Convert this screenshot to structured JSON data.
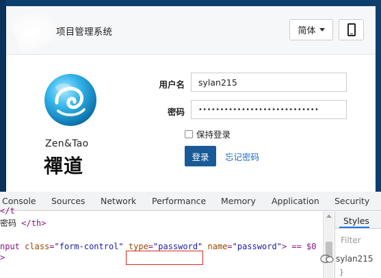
{
  "app": {
    "title": "项目管理系统",
    "lang_label": "简体",
    "mobile_icon": "mobile-phone-icon",
    "logo_text_en": "Zen&Tao",
    "logo_text_cn": "禪道"
  },
  "form": {
    "username_label": "用户名",
    "username_value": "sylan215",
    "password_label": "密码",
    "password_value": "••••••••••••••••••••••••••••",
    "remember_label": "保持登录",
    "login_label": "登录",
    "forgot_label": "忘记密码"
  },
  "devtools": {
    "tabs": [
      "Console",
      "Sources",
      "Network",
      "Performance",
      "Memory",
      "Application",
      "Security"
    ],
    "code": {
      "line1": "</t",
      "line2_text": "密码",
      "line2_tag": "</th>",
      "line3_prefix": "nput",
      "line3_attr1": "class",
      "line3_val1": "\"form-control\"",
      "line3_attr2": "type",
      "line3_val2": "\"password\"",
      "line3_attr3": "name",
      "line3_val3": "\"password\"",
      "line3_suffix": "> == $0",
      "line4": ">"
    },
    "styles_tab": "Styles",
    "filter_placeholder": "Filter",
    "styles_snippet": "}",
    "watermark": "sylan215"
  },
  "colors": {
    "primary": "#1a5a96",
    "link": "#1e6bc6",
    "highlight": "#d9261c"
  }
}
